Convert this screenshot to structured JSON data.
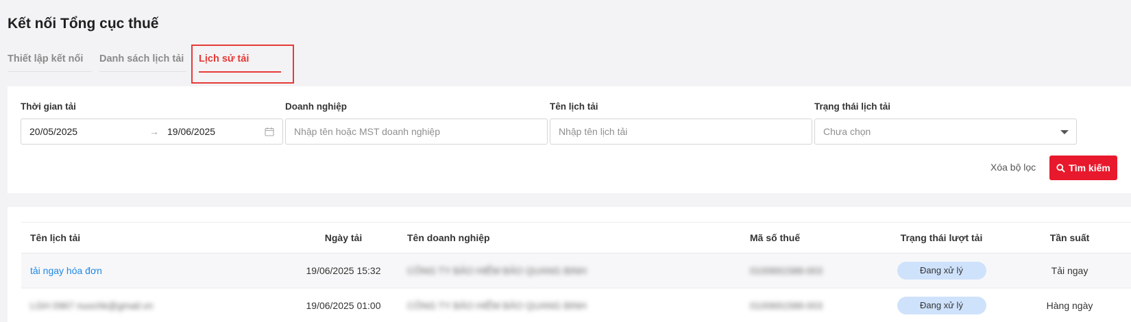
{
  "page": {
    "title": "Kết nối Tổng cục thuế"
  },
  "tabs": [
    {
      "label": "Thiết lập kết nối",
      "active": false
    },
    {
      "label": "Danh sách lịch tải",
      "active": false
    },
    {
      "label": "Lịch sử tải",
      "active": true
    }
  ],
  "filters": {
    "date_label": "Thời gian tải",
    "date_from": "20/05/2025",
    "date_to": "19/06/2025",
    "date_separator": "→",
    "company_label": "Doanh nghiệp",
    "company_placeholder": "Nhập tên hoặc MST doanh nghiệp",
    "schedule_label": "Tên lịch tải",
    "schedule_placeholder": "Nhập tên lịch tải",
    "status_label": "Trạng thái lịch tải",
    "status_placeholder": "Chưa chọn",
    "clear_label": "Xóa bộ lọc",
    "search_label": "Tìm kiếm"
  },
  "table": {
    "headers": [
      "Tên lịch tải",
      "Ngày tải",
      "Tên doanh nghiệp",
      "Mã số thuế",
      "Trạng thái lượt tải",
      "Tần suất"
    ],
    "rows": [
      {
        "name": "tải ngay hóa đơn",
        "date": "19/06/2025 15:32",
        "company": "CÔNG TY BẢO HIỂM BẢO QUANG BINH",
        "tax_code": "0100691588-003",
        "status": "Đang xử lý",
        "frequency": "Tải ngay"
      },
      {
        "name": "LGH 0967 nuochk@gmail.vn",
        "date": "19/06/2025 01:00",
        "company": "CÔNG TY BẢO HIỂM BẢO QUANG BINH",
        "tax_code": "0100691588-003",
        "status": "Đang xử lý",
        "frequency": "Hàng ngày"
      }
    ]
  },
  "colors": {
    "accent": "#e8192c",
    "link": "#1e88e5",
    "badge_bg": "#cfe2fc"
  }
}
